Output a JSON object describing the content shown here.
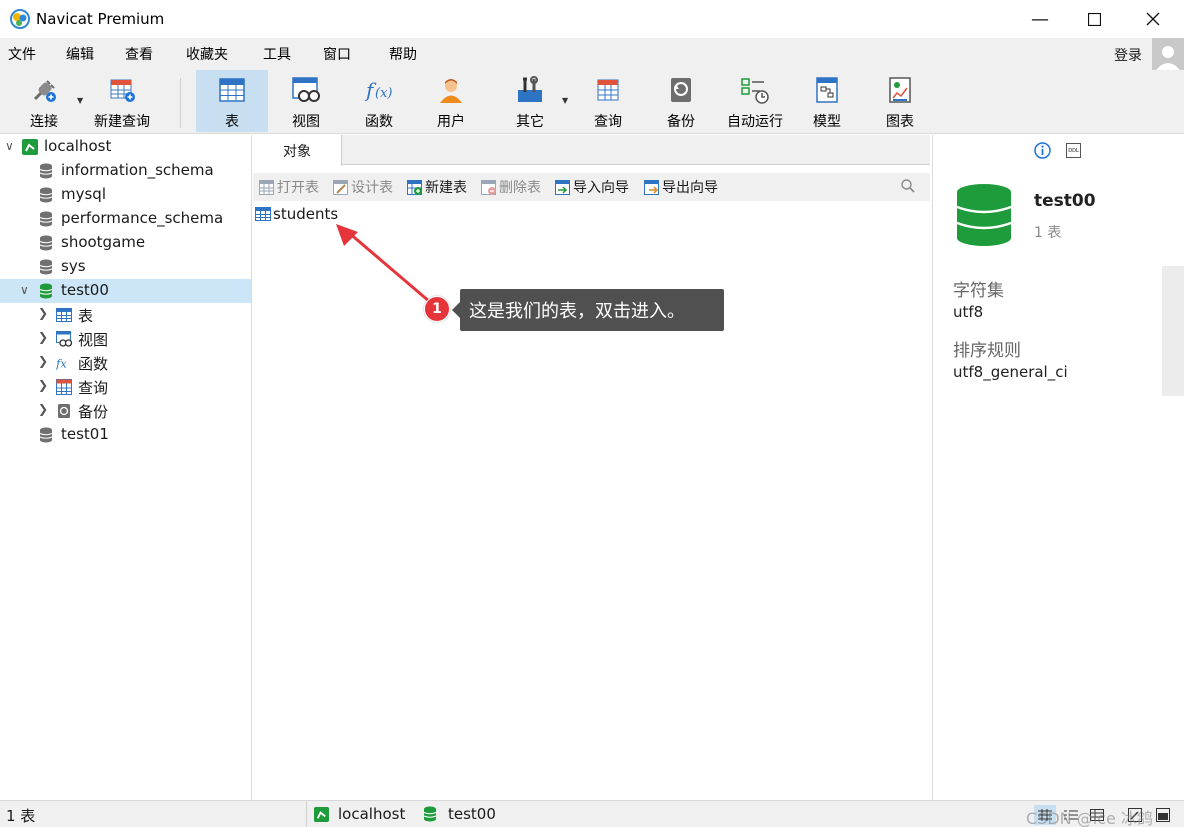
{
  "window": {
    "title": "Navicat Premium"
  },
  "menu": {
    "items": [
      "文件",
      "编辑",
      "查看",
      "收藏夹",
      "工具",
      "窗口",
      "帮助"
    ],
    "login": "登录"
  },
  "toolbar": {
    "connect": "连接",
    "new_query": "新建查询",
    "table": "表",
    "view": "视图",
    "function": "函数",
    "user": "用户",
    "other": "其它",
    "query": "查询",
    "backup": "备份",
    "auto_run": "自动运行",
    "model": "模型",
    "chart": "图表",
    "active": "表"
  },
  "nav_tree": {
    "connection": "localhost",
    "databases": [
      "information_schema",
      "mysql",
      "performance_schema",
      "shootgame",
      "sys",
      "test00",
      "test01"
    ],
    "selected_db": "test00",
    "children": [
      "表",
      "视图",
      "函数",
      "查询",
      "备份"
    ]
  },
  "center": {
    "tab": "对象",
    "obj_toolbar": {
      "open_table": "打开表",
      "design_table": "设计表",
      "new_table": "新建表",
      "delete_table": "删除表",
      "import_wizard": "导入向导",
      "export_wizard": "导出向导"
    },
    "objects": [
      "students"
    ]
  },
  "annotation": {
    "number": "1",
    "text": "这是我们的表，双击进入。"
  },
  "info_panel": {
    "db_name": "test00",
    "table_count": "1 表",
    "charset_label": "字符集",
    "charset_value": "utf8",
    "collation_label": "排序规则",
    "collation_value": "utf8_general_ci",
    "ddl_badge": "DDL"
  },
  "status": {
    "count": "1 表",
    "connection": "localhost",
    "database": "test00",
    "watermark": "CSDN @ice 冰鸽"
  },
  "colors": {
    "accent": "#1a73d9",
    "db_green": "#1e9b3a",
    "selection": "#cde6f7",
    "callout_bg": "#505050",
    "badge_red": "#e5343a"
  }
}
